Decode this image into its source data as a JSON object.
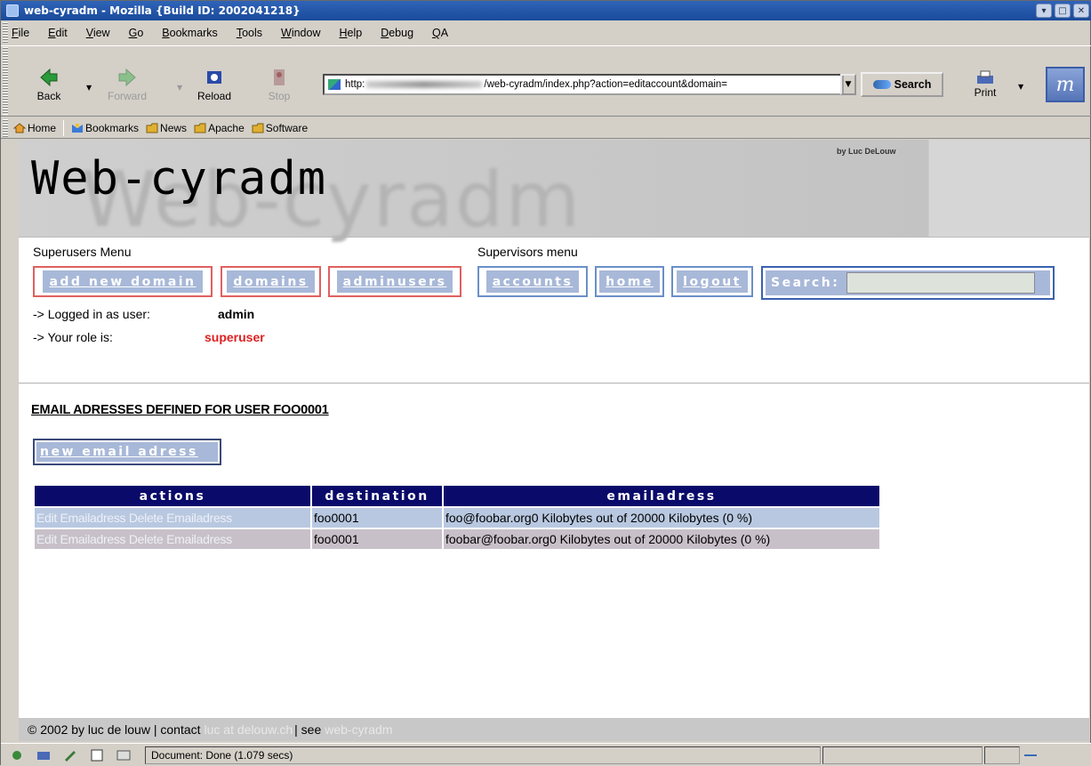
{
  "window": {
    "title": "web-cyradm - Mozilla {Build ID: 2002041218}"
  },
  "menubar": [
    "File",
    "Edit",
    "View",
    "Go",
    "Bookmarks",
    "Tools",
    "Window",
    "Help",
    "Debug",
    "QA"
  ],
  "navbar": {
    "back": "Back",
    "forward": "Forward",
    "reload": "Reload",
    "stop": "Stop",
    "url_prefix": "http:",
    "url_suffix": "/web-cyradm/index.php?action=editaccount&domain=",
    "search": "Search",
    "print": "Print"
  },
  "personal_toolbar": [
    "Home",
    "Bookmarks",
    "News",
    "Apache",
    "Software"
  ],
  "banner": {
    "logo": "Web-cyradm",
    "ghost": "Web-cyradm",
    "byline": "by Luc DeLouw"
  },
  "menus": {
    "superusers_label": "Superusers Menu",
    "supervisors_label": "Supervisors menu",
    "add_new_domain": "add new domain",
    "domains": "domains",
    "adminusers": "adminusers",
    "accounts": "accounts",
    "home": "home",
    "logout": "logout",
    "search": "Search:"
  },
  "info": {
    "logged_label": "-> Logged in as user:",
    "logged_value": "admin",
    "role_label": "-> Your role is:",
    "role_value": "superuser"
  },
  "main": {
    "heading": "EMAIL ADRESSES DEFINED FOR USER FOO0001",
    "new_email_button": "new email adress",
    "table": {
      "headers": [
        "actions",
        "destination",
        "emailadress"
      ],
      "rows": [
        {
          "edit": "Edit Emailadress",
          "delete": "Delete Emailadress",
          "destination": "foo0001",
          "email": "foo@foobar.org0 Kilobytes out of 20000 Kilobytes (0 %)"
        },
        {
          "edit": "Edit Emailadress",
          "delete": "Delete Emailadress",
          "destination": "foo0001",
          "email": "foobar@foobar.org0 Kilobytes out of 20000 Kilobytes (0 %)"
        }
      ]
    }
  },
  "footer": {
    "copyright": "© 2002 by luc de louw | contact",
    "email": "luc at delouw.ch",
    "see": "| see",
    "link": "web-cyradm"
  },
  "status": {
    "message": "Document: Done (1.079 secs)"
  },
  "colors": {
    "button_fill": "#a8b8d8",
    "table_header": "#0a0a6a",
    "role": "#e02020"
  }
}
